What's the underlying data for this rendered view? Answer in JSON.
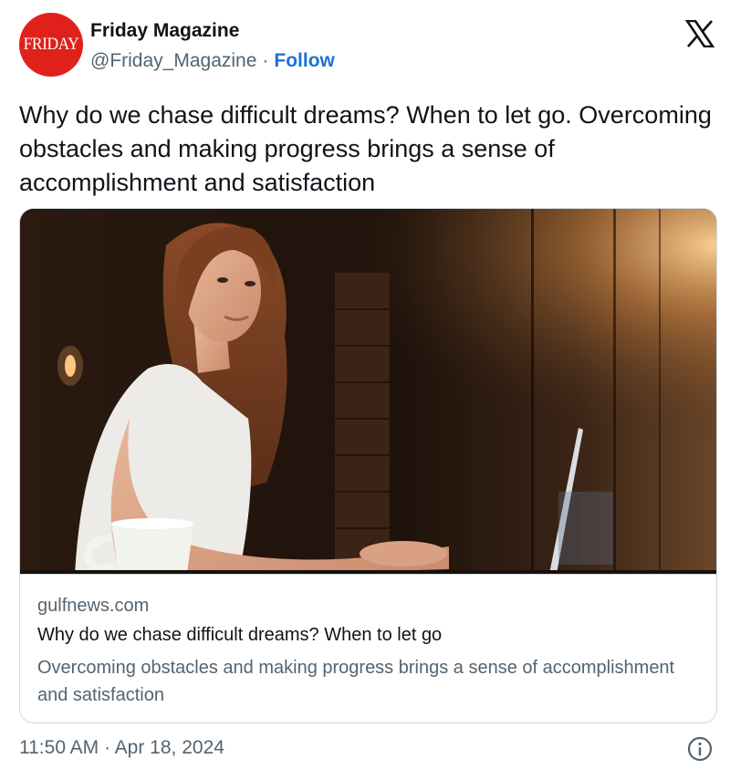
{
  "author": {
    "avatar_text": "FRIDAY",
    "display_name": "Friday Magazine",
    "handle": "@Friday_Magazine",
    "separator": "·",
    "follow_label": "Follow"
  },
  "platform_icon": "x-logo-icon",
  "tweet": {
    "text": "Why do we chase difficult dreams? When to let go. Overcoming obstacles and making progress brings a sense of accomplishment and satisfaction"
  },
  "card": {
    "domain": "gulfnews.com",
    "title": "Why do we chase difficult dreams? When to let go",
    "description": "Overcoming obstacles and making progress brings a sense of accomplishment and satisfaction"
  },
  "footer": {
    "timestamp": "11:50 AM · Apr 18, 2024",
    "info_icon": "info-icon"
  },
  "colors": {
    "avatar_bg": "#e0211b",
    "follow_link": "#1d70d6",
    "secondary_text": "#536471",
    "primary_text": "#0f1419",
    "card_border": "#cfd9de"
  }
}
